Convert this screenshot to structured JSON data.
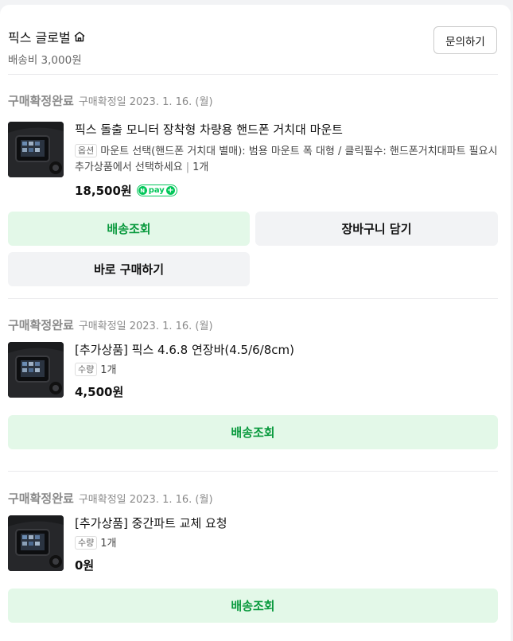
{
  "store": {
    "name": "픽스 글로벌",
    "shipping": "배송비 3,000원",
    "inquiry_label": "문의하기"
  },
  "groups": [
    {
      "status": "구매확정완료",
      "date": "구매확정일 2023. 1. 16. (월)",
      "product_name": "픽스 돌출 모니터 장착형 차량용 핸드폰 거치대 마운트",
      "option_tag": "옵션",
      "option_text": "마운트 선택(핸드폰 거치대 별매): 범용 마운트 폭 대형 / 클릭필수: 핸드폰거치대파트 필요시 추가상품에서 선택하세요",
      "qty": "1개",
      "price": "18,500원",
      "npay_label": "pay",
      "buttons": {
        "track": "배송조회",
        "cart": "장바구니 담기",
        "buy_now": "바로 구매하기"
      }
    },
    {
      "status": "구매확정완료",
      "date": "구매확정일 2023. 1. 16. (월)",
      "product_name": "[추가상품] 픽스 4.6.8 연장바(4.5/6/8cm)",
      "option_tag": "수량",
      "qty": "1개",
      "price": "4,500원",
      "buttons": {
        "track": "배송조회"
      }
    },
    {
      "status": "구매확정완료",
      "date": "구매확정일 2023. 1. 16. (월)",
      "product_name": "[추가상품] 중간파트 교체 요청",
      "option_tag": "수량",
      "qty": "1개",
      "price": "0원",
      "buttons": {
        "track": "배송조회"
      }
    }
  ],
  "colors": {
    "accent_green": "#03c75a",
    "track_button_bg": "#e3f8e8",
    "track_button_text": "#0a9a3e",
    "secondary_button_bg": "#f2f3f5"
  }
}
